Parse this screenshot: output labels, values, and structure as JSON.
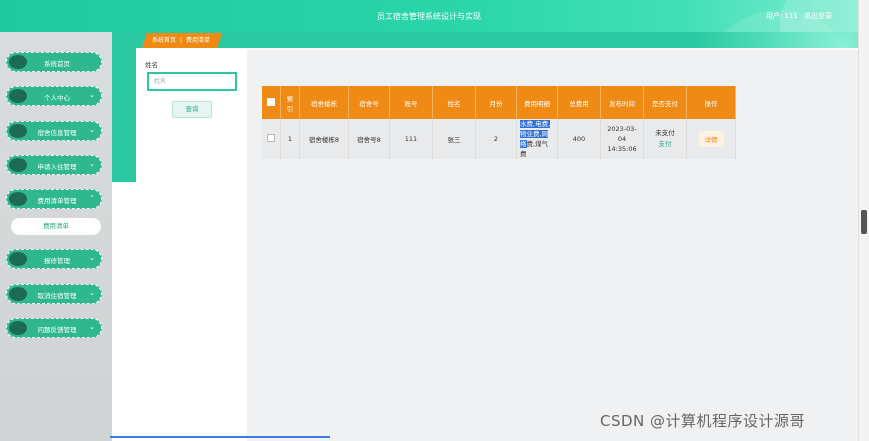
{
  "header": {
    "title": "员工宿舍管理系统设计与实现",
    "user_label": "用户: 111",
    "logout_label": "退出登录"
  },
  "sidebar": {
    "items": [
      {
        "label": "系统首页",
        "chevron": ""
      },
      {
        "label": "个人中心",
        "chevron": "⌄"
      },
      {
        "label": "宿舍信息管理",
        "chevron": "⌄"
      },
      {
        "label": "申请入住管理",
        "chevron": "⌄"
      },
      {
        "label": "费用清单管理",
        "chevron": "⌃"
      },
      {
        "label": "报修管理",
        "chevron": "⌄"
      },
      {
        "label": "取消住宿管理",
        "chevron": "⌄"
      },
      {
        "label": "问题反馈管理",
        "chevron": "⌄"
      }
    ],
    "sub_item": "费用清单"
  },
  "breadcrumb": {
    "home": "系统首页",
    "separator": "|",
    "current": "费用清单"
  },
  "filter": {
    "label": "姓名",
    "placeholder": "姓名",
    "query_button": "查询"
  },
  "table": {
    "headers": [
      "",
      "索引",
      "宿舍楼栋",
      "宿舍号",
      "账号",
      "姓名",
      "月份",
      "费用明细",
      "总费用",
      "发布时间",
      "是否支付",
      "操作"
    ],
    "rows": [
      {
        "index": "1",
        "building": "宿舍楼栋8",
        "room": "宿舍号8",
        "account": "111",
        "name": "张三",
        "month": "2",
        "detail_highlighted": "水费,电费,物业费,网络",
        "detail_rest": "费,煤气费",
        "total": "400",
        "publish_time": "2023-03-04 14:35:06",
        "paid": "未支付",
        "pay_link": "支付",
        "action": "详情"
      }
    ]
  },
  "watermark": "CSDN @计算机程序设计源哥",
  "colors": {
    "accent_green": "#2bc9a2",
    "accent_orange": "#ef8a14",
    "sidebar_button": "#2fb88f"
  }
}
